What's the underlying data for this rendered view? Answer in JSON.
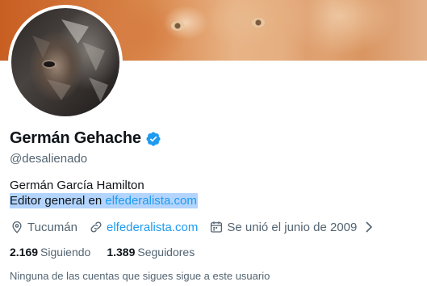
{
  "profile": {
    "display_name": "Germán Gehache",
    "handle": "@desalienado",
    "verified_icon": "verified-badge-icon",
    "bio_line1": "Germán García Hamilton",
    "bio_line2_prefix": "Editor general en ",
    "bio_line2_link": "elfederalista.com",
    "location": "Tucumán",
    "website": "elfederalista.com",
    "joined": "Se unió el junio de 2009",
    "following_count": "2.169",
    "following_label": "Siguiendo",
    "followers_count": "1.389",
    "followers_label": "Seguidores",
    "followers_you_know": "Ninguna de las cuentas que sigues sigue a este usuario"
  },
  "colors": {
    "accent": "#1d9bf0",
    "text_primary": "#0f1419",
    "text_secondary": "#536471",
    "selection": "#b3d4fc"
  }
}
